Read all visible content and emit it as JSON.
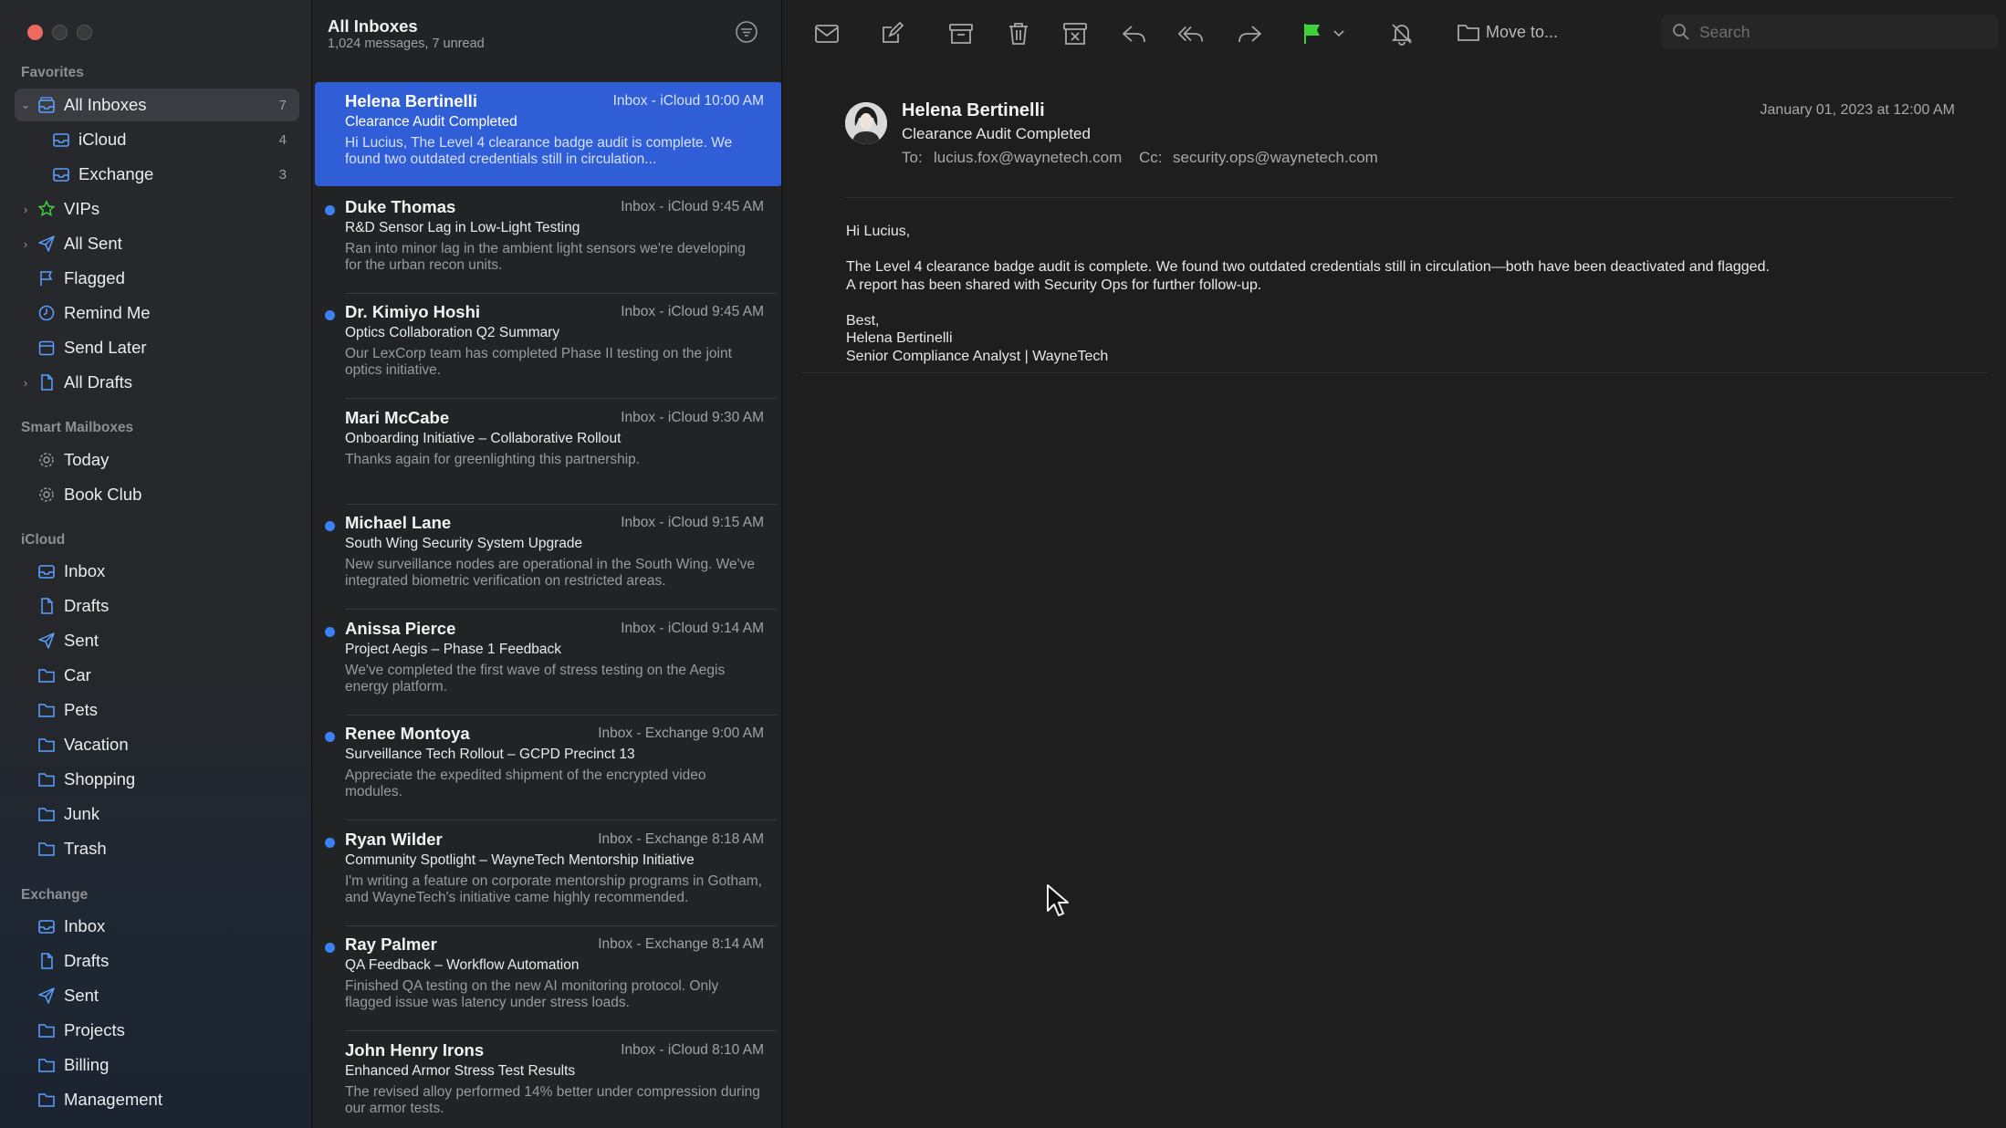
{
  "sidebar": {
    "sections": {
      "favorites": "Favorites",
      "smart": "Smart Mailboxes",
      "icloud": "iCloud",
      "exchange": "Exchange"
    },
    "favorites": [
      {
        "label": "All Inboxes",
        "count": "7"
      },
      {
        "label": "iCloud",
        "count": "4"
      },
      {
        "label": "Exchange",
        "count": "3"
      },
      {
        "label": "VIPs"
      },
      {
        "label": "All Sent"
      },
      {
        "label": "Flagged"
      },
      {
        "label": "Remind Me"
      },
      {
        "label": "Send Later"
      },
      {
        "label": "All Drafts"
      }
    ],
    "smart": [
      {
        "label": "Today"
      },
      {
        "label": "Book Club"
      }
    ],
    "icloud": [
      {
        "label": "Inbox"
      },
      {
        "label": "Drafts"
      },
      {
        "label": "Sent"
      },
      {
        "label": "Car"
      },
      {
        "label": "Pets"
      },
      {
        "label": "Vacation"
      },
      {
        "label": "Shopping"
      },
      {
        "label": "Junk"
      },
      {
        "label": "Trash"
      }
    ],
    "exchange": [
      {
        "label": "Inbox"
      },
      {
        "label": "Drafts"
      },
      {
        "label": "Sent"
      },
      {
        "label": "Projects"
      },
      {
        "label": "Billing"
      },
      {
        "label": "Management"
      }
    ]
  },
  "list": {
    "title": "All Inboxes",
    "subtitle": "1,024 messages, 7 unread",
    "messages": [
      {
        "from": "Helena Bertinelli",
        "meta": "Inbox - iCloud  10:00 AM",
        "subject": "Clearance Audit Completed",
        "preview": "Hi Lucius, The Level 4 clearance badge audit is complete. We found two outdated credentials still in circulation..."
      },
      {
        "from": "Duke Thomas",
        "meta": "Inbox - iCloud  9:45 AM",
        "subject": "R&D Sensor Lag in Low-Light Testing",
        "preview": "Ran into minor lag in the ambient light sensors we're developing for the urban recon units."
      },
      {
        "from": "Dr. Kimiyo Hoshi",
        "meta": "Inbox - iCloud  9:45 AM",
        "subject": "Optics Collaboration Q2 Summary",
        "preview": "Our LexCorp team has completed Phase II testing on the joint optics initiative."
      },
      {
        "from": "Mari McCabe",
        "meta": "Inbox - iCloud  9:30 AM",
        "subject": "Onboarding Initiative – Collaborative Rollout",
        "preview": "Thanks again for greenlighting this partnership."
      },
      {
        "from": "Michael Lane",
        "meta": "Inbox - iCloud  9:15 AM",
        "subject": "South Wing Security System Upgrade",
        "preview": "New surveillance nodes are operational in the South Wing. We've integrated biometric verification on restricted areas."
      },
      {
        "from": "Anissa Pierce",
        "meta": "Inbox - iCloud  9:14 AM",
        "subject": "Project Aegis – Phase 1 Feedback",
        "preview": "We've completed the first wave of stress testing on the Aegis energy platform."
      },
      {
        "from": "Renee Montoya",
        "meta": "Inbox - Exchange  9:00 AM",
        "subject": "Surveillance Tech Rollout – GCPD Precinct 13",
        "preview": "Appreciate the expedited shipment of the encrypted video modules."
      },
      {
        "from": "Ryan Wilder",
        "meta": "Inbox - Exchange  8:18 AM",
        "subject": "Community Spotlight – WayneTech Mentorship Initiative",
        "preview": "I'm writing a feature on corporate mentorship programs in Gotham, and WayneTech's initiative came highly recommended."
      },
      {
        "from": "Ray Palmer",
        "meta": "Inbox - Exchange  8:14 AM",
        "subject": "QA Feedback – Workflow Automation",
        "preview": "Finished QA testing on the new AI monitoring protocol. Only flagged issue was latency under stress loads."
      },
      {
        "from": "John Henry Irons",
        "meta": "Inbox - iCloud  8:10 AM",
        "subject": "Enhanced Armor Stress Test Results",
        "preview": "The revised alloy performed 14% better under compression during our armor tests."
      }
    ]
  },
  "toolbar": {
    "move_to": "Move to...",
    "search_placeholder": "Search"
  },
  "reader": {
    "from": "Helena Bertinelli",
    "subject": "Clearance Audit Completed",
    "to_label": "To:",
    "to": "lucius.fox@waynetech.com",
    "cc_label": "Cc:",
    "cc": "security.ops@waynetech.com",
    "date": "January 01, 2023 at 12:00 AM",
    "body": [
      "Hi Lucius,",
      "",
      "The Level 4 clearance badge audit is complete. We found two outdated credentials still in circulation—both have been deactivated and flagged.",
      "A report has been shared with Security Ops for further follow-up.",
      "",
      "Best,",
      "Helena Bertinelli",
      "Senior Compliance Analyst | WayneTech"
    ]
  },
  "colors": {
    "accent": "#2f5ed6",
    "unread_dot": "#3b82f6",
    "flag": "#3fd13a",
    "close": "#ed6a5e"
  }
}
